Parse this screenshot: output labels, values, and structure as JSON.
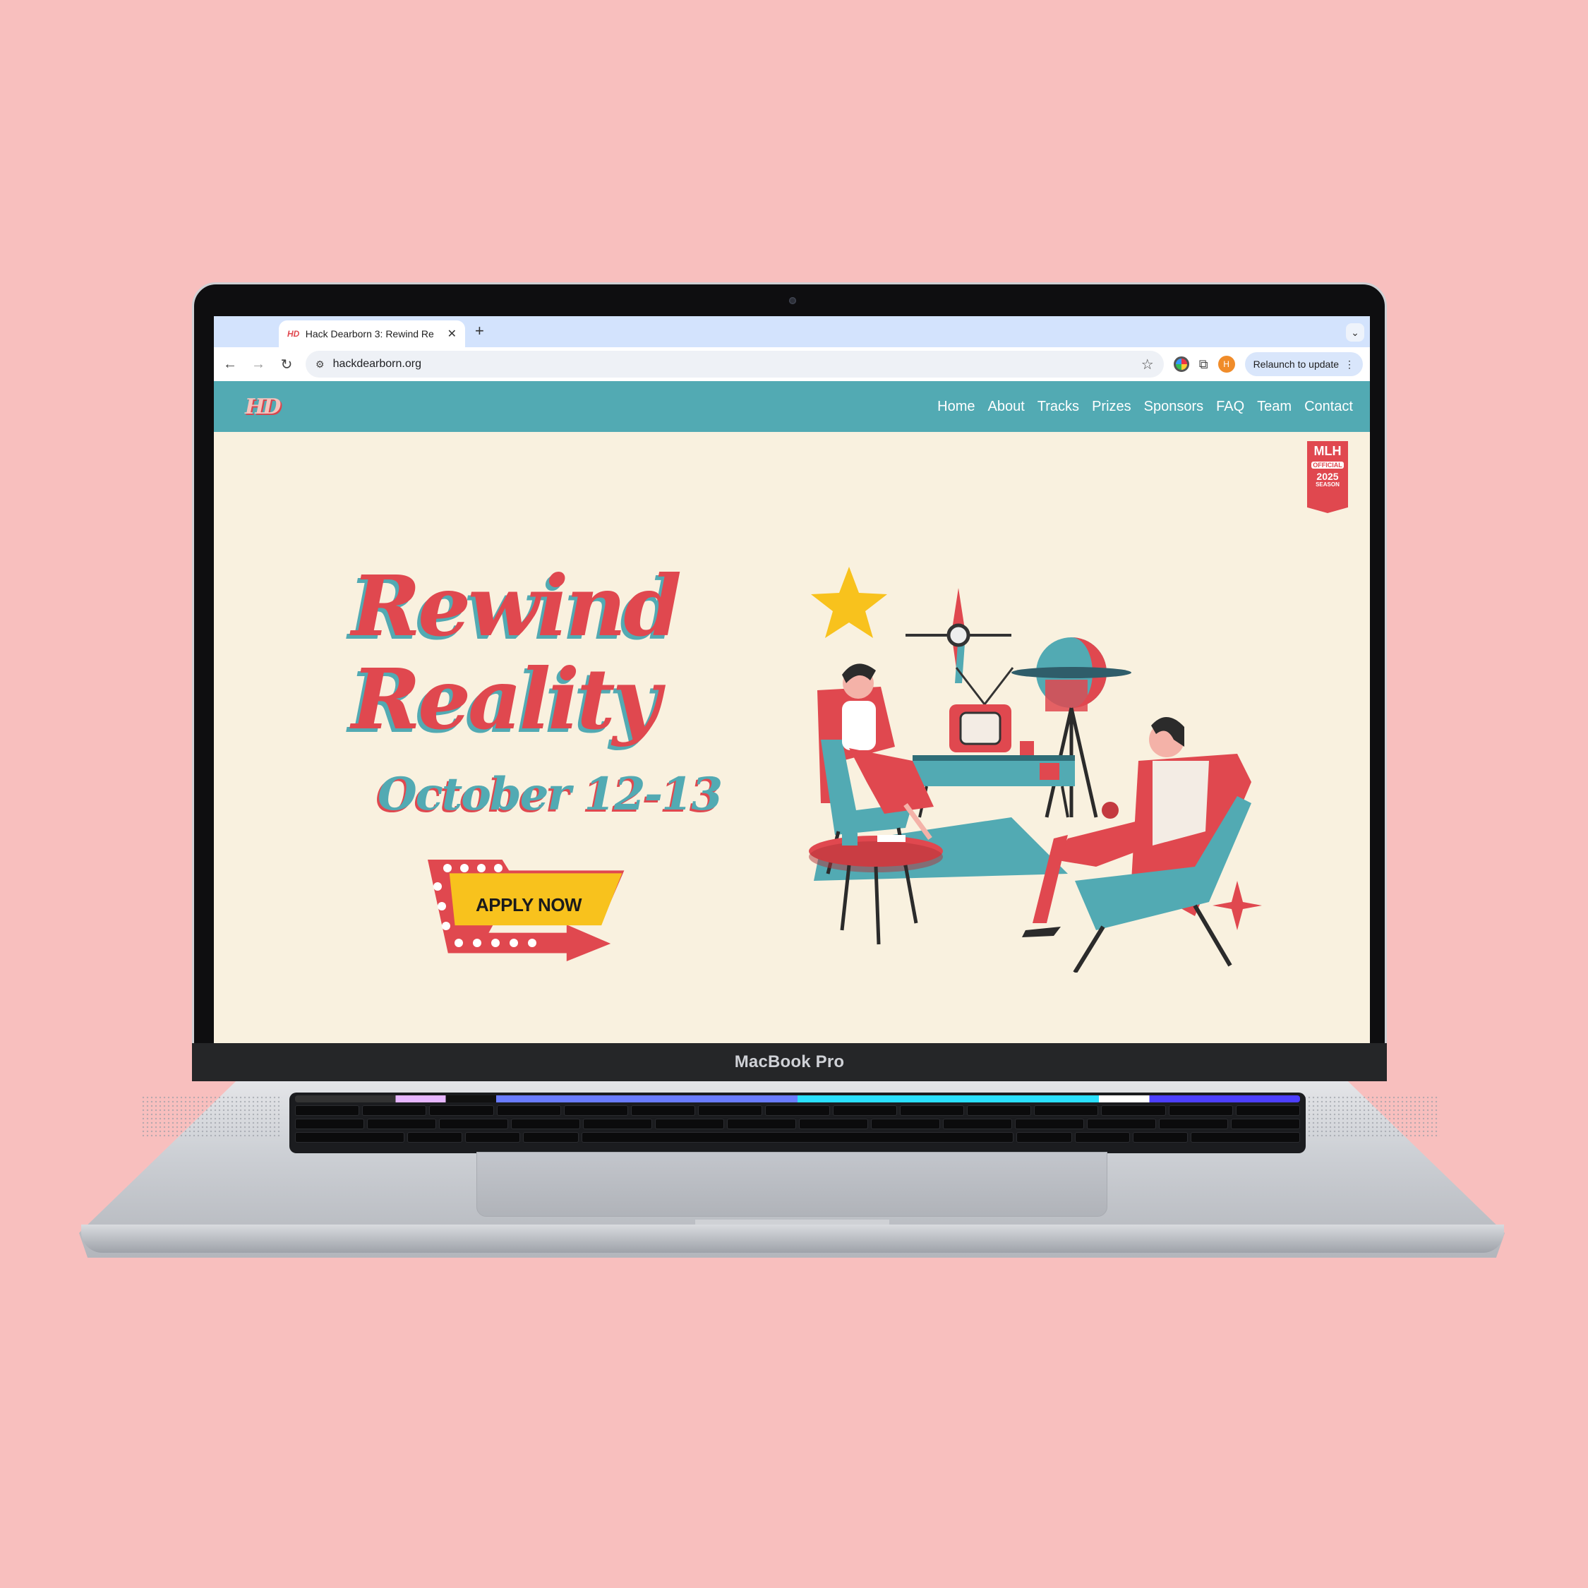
{
  "device": {
    "model_label": "MacBook Pro"
  },
  "browser": {
    "tab_title": "Hack Dearborn 3: Rewind Re",
    "url": "hackdearborn.org",
    "profile_initial": "H",
    "relaunch_label": "Relaunch to update"
  },
  "site": {
    "logo_text": "HD",
    "nav": [
      "Home",
      "About",
      "Tracks",
      "Prizes",
      "Sponsors",
      "FAQ",
      "Team",
      "Contact"
    ],
    "badge": {
      "top": "MLH",
      "middle": "OFFICIAL",
      "year": "2025",
      "bottom": "SEASON"
    },
    "hero": {
      "title_line1": "Rewind",
      "title_line2": "Reality",
      "date": "October 12-13",
      "cta": "APPLY NOW"
    }
  },
  "colors": {
    "page_bg": "#f8bfbe",
    "teal": "#52aab3",
    "red": "#e0484f",
    "cream": "#f9f1df",
    "yellow": "#f8c21d"
  }
}
